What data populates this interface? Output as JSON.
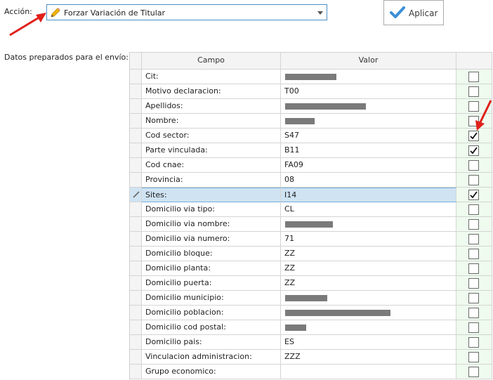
{
  "accion": {
    "label": "Acción:",
    "selected": "Forzar Variación de Titular"
  },
  "aplicar": {
    "label": "Aplicar"
  },
  "datos_label": "Datos preparados para el envío:",
  "grid": {
    "columns": [
      "Campo",
      "Valor",
      ""
    ],
    "rows": [
      {
        "campo": "Cit:",
        "valor": "",
        "checked": false
      },
      {
        "campo": "Motivo declaracion:",
        "valor": "T00",
        "checked": false
      },
      {
        "campo": "Apellidos:",
        "valor": "",
        "checked": false
      },
      {
        "campo": "Nombre:",
        "valor": "",
        "checked": false
      },
      {
        "campo": "Cod sector:",
        "valor": "S47",
        "checked": true
      },
      {
        "campo": "Parte vinculada:",
        "valor": "B11",
        "checked": true
      },
      {
        "campo": "Cod cnae:",
        "valor": "FA09",
        "checked": false
      },
      {
        "campo": "Provincia:",
        "valor": "08",
        "checked": false
      },
      {
        "campo": "Sites:",
        "valor": "I14",
        "checked": true,
        "selected": true
      },
      {
        "campo": "Domicilio via tipo:",
        "valor": "CL",
        "checked": false
      },
      {
        "campo": "Domicilio via nombre:",
        "valor": "",
        "checked": false
      },
      {
        "campo": "Domicilio via numero:",
        "valor": "71",
        "checked": false
      },
      {
        "campo": "Domicilio bloque:",
        "valor": "ZZ",
        "checked": false
      },
      {
        "campo": "Domicilio planta:",
        "valor": "ZZ",
        "checked": false
      },
      {
        "campo": "Domicilio puerta:",
        "valor": "ZZ",
        "checked": false
      },
      {
        "campo": "Domicilio municipio:",
        "valor": "",
        "checked": false
      },
      {
        "campo": "Domicilio poblacion:",
        "valor": "",
        "checked": false
      },
      {
        "campo": "Domicilio cod postal:",
        "valor": "",
        "checked": false
      },
      {
        "campo": "Domicilio pais:",
        "valor": "ES",
        "checked": false
      },
      {
        "campo": "Vinculacion administracion:",
        "valor": "ZZZ",
        "checked": false
      },
      {
        "campo": "Grupo economico:",
        "valor": "",
        "checked": false
      }
    ]
  },
  "colors": {
    "accent": "#e0201b",
    "selection": "#cfe3f3",
    "check_column": "#eefbee",
    "check_mark": "#3a8fd6"
  },
  "icons": [
    "pencil-icon",
    "checkmark-icon",
    "red-arrow-annotation"
  ]
}
